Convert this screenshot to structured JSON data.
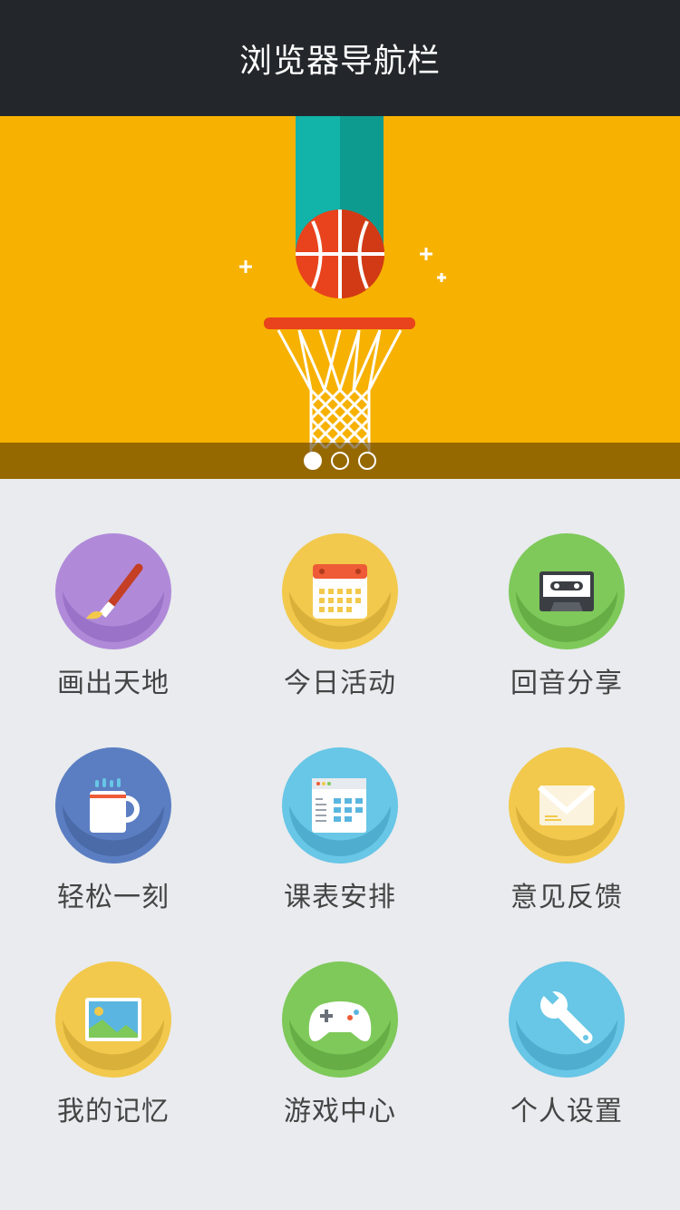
{
  "header": {
    "title": "浏览器导航栏"
  },
  "banner": {
    "background": "#f7b100",
    "slides_total": 3,
    "active_slide": 1
  },
  "menu": {
    "items": [
      {
        "label": "画出天地",
        "icon": "paintbrush-icon",
        "color": "#b08ad9"
      },
      {
        "label": "今日活动",
        "icon": "calendar-icon",
        "color": "#f2c94c"
      },
      {
        "label": "回音分享",
        "icon": "cassette-icon",
        "color": "#7ec95a"
      },
      {
        "label": "轻松一刻",
        "icon": "coffee-mug-icon",
        "color": "#5b7ec2"
      },
      {
        "label": "课表安排",
        "icon": "schedule-icon",
        "color": "#68c6e6"
      },
      {
        "label": "意见反馈",
        "icon": "envelope-icon",
        "color": "#f2c94c"
      },
      {
        "label": "我的记忆",
        "icon": "picture-icon",
        "color": "#f2c94c"
      },
      {
        "label": "游戏中心",
        "icon": "gamepad-icon",
        "color": "#7ec95a"
      },
      {
        "label": "个人设置",
        "icon": "wrench-icon",
        "color": "#68c6e6"
      }
    ]
  }
}
